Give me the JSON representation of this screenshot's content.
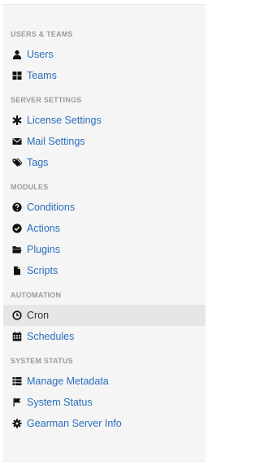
{
  "sections": [
    {
      "title": "USERS & TEAMS",
      "items": [
        {
          "label": "Users",
          "icon": "user-icon"
        },
        {
          "label": "Teams",
          "icon": "grid-icon"
        }
      ]
    },
    {
      "title": "SERVER SETTINGS",
      "items": [
        {
          "label": "License Settings",
          "icon": "asterisk-icon"
        },
        {
          "label": "Mail Settings",
          "icon": "envelope-icon"
        },
        {
          "label": "Tags",
          "icon": "tags-icon"
        }
      ]
    },
    {
      "title": "MODULES",
      "items": [
        {
          "label": "Conditions",
          "icon": "question-circle-icon"
        },
        {
          "label": "Actions",
          "icon": "check-circle-icon"
        },
        {
          "label": "Plugins",
          "icon": "folder-open-icon"
        },
        {
          "label": "Scripts",
          "icon": "file-icon"
        }
      ]
    },
    {
      "title": "AUTOMATION",
      "items": [
        {
          "label": "Cron",
          "icon": "clock-icon",
          "active": true
        },
        {
          "label": "Schedules",
          "icon": "calendar-icon"
        }
      ]
    },
    {
      "title": "SYSTEM STATUS",
      "items": [
        {
          "label": "Manage Metadata",
          "icon": "list-icon"
        },
        {
          "label": "System Status",
          "icon": "flag-icon"
        },
        {
          "label": "Gearman Server Info",
          "icon": "cog-icon"
        }
      ]
    }
  ],
  "colors": {
    "link": "#2a6ebb",
    "active_text": "#333333",
    "header": "#9a9a9a",
    "active_bg": "#e6e6e6",
    "panel_bg": "#f5f5f5"
  }
}
